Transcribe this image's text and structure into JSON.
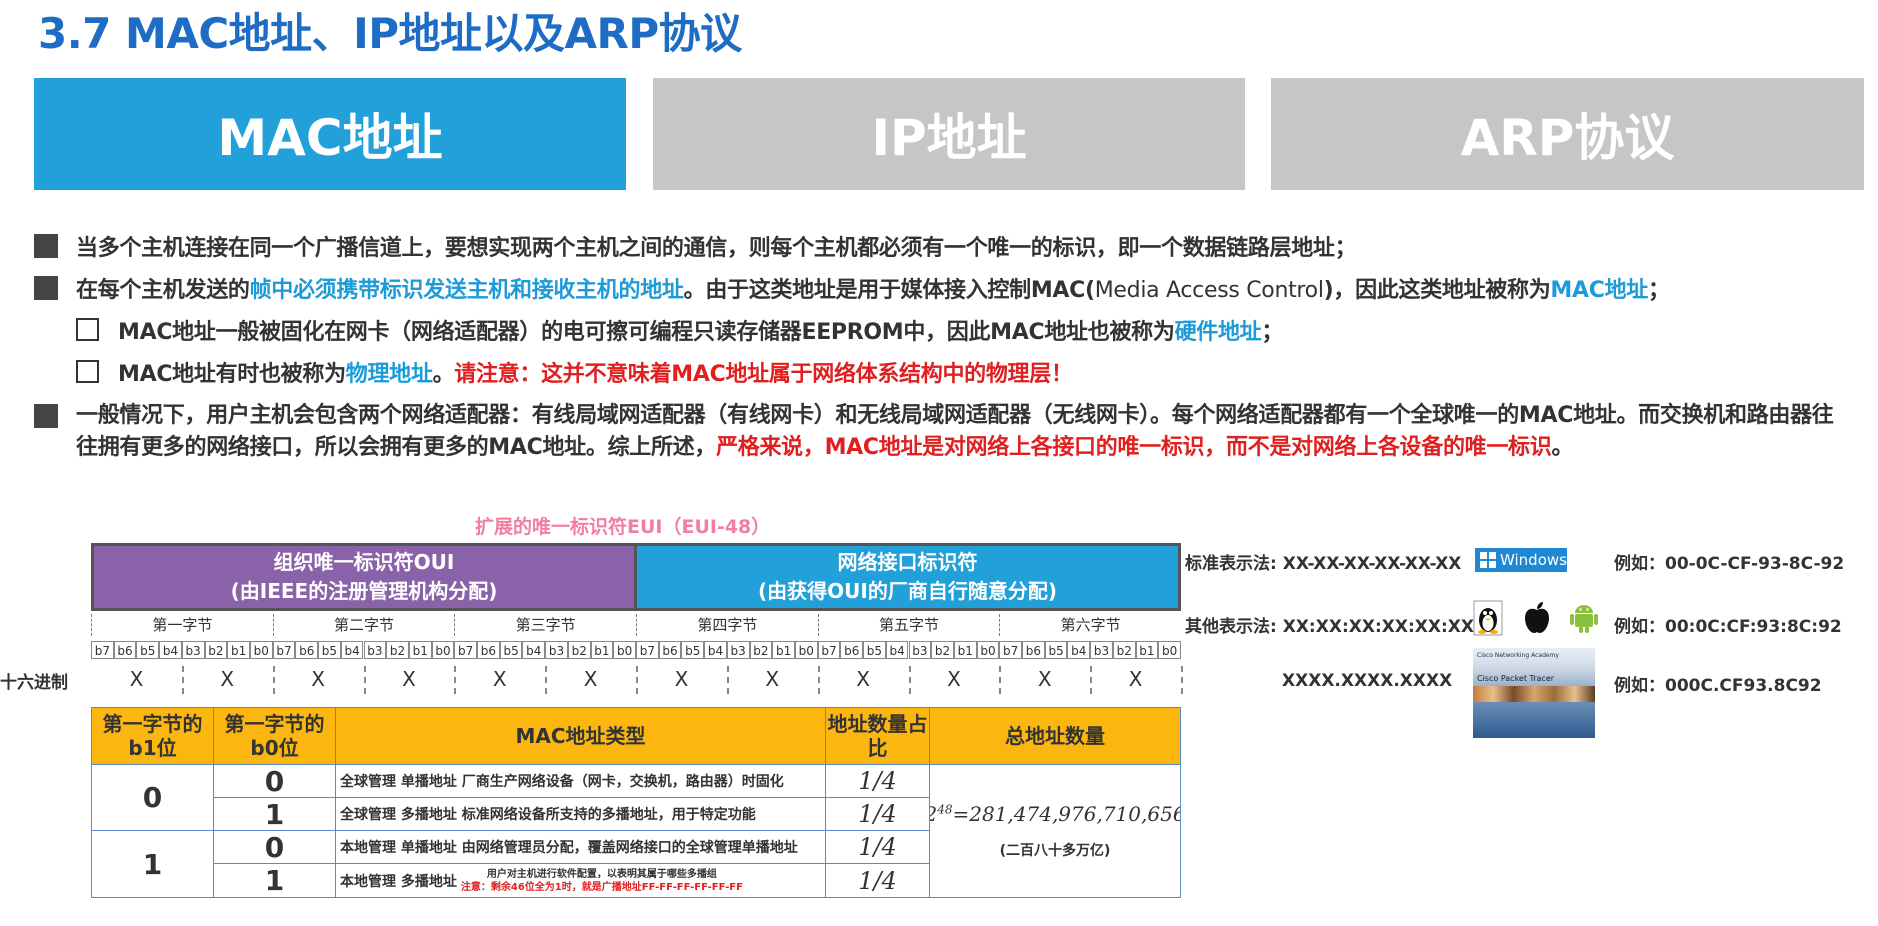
{
  "title": "3.7 MAC地址、IP地址以及ARP协议",
  "tabs": [
    {
      "label": "MAC地址",
      "active": true
    },
    {
      "label": "IP地址",
      "active": false
    },
    {
      "label": "ARP协议",
      "active": false
    }
  ],
  "colors": {
    "accent": "#21a0d9",
    "title": "#1f6cc4",
    "highlight_blue": "#1d9bd8",
    "highlight_red": "#e02020",
    "oui": "#8a62aa",
    "table_header": "#fbb710",
    "inactive_tab": "#c6c6c6"
  },
  "bullets": {
    "b1": "当多个主机连接在同一个广播信道上，要想实现两个主机之间的通信，则每个主机都必须有一个唯一的标识，即一个数据链路层地址；",
    "b2_a": "在每个主机发送的",
    "b2_b": "帧中必须携带标识发送主机和接收主机的地址",
    "b2_c": "。由于这类地址是用于媒体接入控制MAC(",
    "b2_d": "Media Access Control",
    "b2_e": ")，因此这类地址被称为",
    "b2_f": "MAC地址",
    "b2_g": "；",
    "s1_a": "MAC地址一般被固化在网卡（网络适配器）的电可擦可编程只读存储器EEPROM中，因此MAC地址也被称为",
    "s1_b": "硬件地址",
    "s1_c": "；",
    "s2_a": "MAC地址有时也被称为",
    "s2_b": "物理地址",
    "s2_c": "。",
    "s2_d": "请注意：这并不意味着MAC地址属于网络体系结构中的物理层！",
    "b3_a": "一般情况下，用户主机会包含两个网络适配器：有线局域网适配器（有线网卡）和无线局域网适配器（无线网卡）。每个网络适配器都有一个全球唯一的MAC地址。而交换机和路由器往往拥有更多的网络接口，所以会拥有更多的MAC地址。综上所述，",
    "b3_b": "严格来说，MAC地址是对网络上各接口的唯一标识，而不是对网络上各设备的唯一标识",
    "b3_c": "。"
  },
  "eui": {
    "label": "扩展的唯一标识符EUI（EUI-48）",
    "oui_line1": "组织唯一标识符OUI",
    "oui_line2": "(由IEEE的注册管理机构分配)",
    "nic_line1": "网络接口标识符",
    "nic_line2": "(由获得OUI的厂商自行随意分配)",
    "bytes": [
      "第一字节",
      "第二字节",
      "第三字节",
      "第四字节",
      "第五字节",
      "第六字节"
    ],
    "bits": [
      "b7",
      "b6",
      "b5",
      "b4",
      "b3",
      "b2",
      "b1",
      "b0"
    ],
    "hex_label": "十六进制",
    "hex_digit": "X"
  },
  "formats": {
    "standard_label": "标准表示法: XX-XX-XX-XX-XX-XX",
    "standard_example": "例如：00-0C-CF-93-8C-92",
    "windows": "Windows",
    "other_label": "其他表示法: XX:XX:XX:XX:XX:XX",
    "other_example": "例如：00:0C:CF:93:8C:92",
    "cisco_label": "XXXX.XXXX.XXXX",
    "cisco_example": "例如：000C.CF93.8C92",
    "cisco_caption1": "Cisco Networking Academy",
    "cisco_caption2": "Cisco Packet Tracer"
  },
  "table": {
    "headers": [
      "第一字节的b1位",
      "第一字节的b0位",
      "MAC地址类型",
      "地址数量占比",
      "总地址数量"
    ],
    "b1_values": [
      "0",
      "1"
    ],
    "b0_values": [
      "0",
      "1",
      "0",
      "1"
    ],
    "types": [
      "全球管理 单播地址 厂商生产网络设备（网卡，交换机，路由器）时固化",
      "全球管理 多播地址 标准网络设备所支持的多播地址，用于特定功能",
      "本地管理 单播地址 由网络管理员分配，覆盖网络接口的全球管理单播地址"
    ],
    "type4_prefix": "本地管理 多播地址",
    "type4_line1": "用户对主机进行软件配置，以表明其属于哪些多播组",
    "type4_line2": "注意：剩余46位全为1时，就是广播地址FF-FF-FF-FF-FF-FF",
    "ratios": [
      "1/4",
      "1/4",
      "1/4",
      "1/4"
    ],
    "total_base": "2",
    "total_exp": "48",
    "total_value": "=281,474,976,710,656",
    "total_note": "(二百八十多万亿)"
  }
}
